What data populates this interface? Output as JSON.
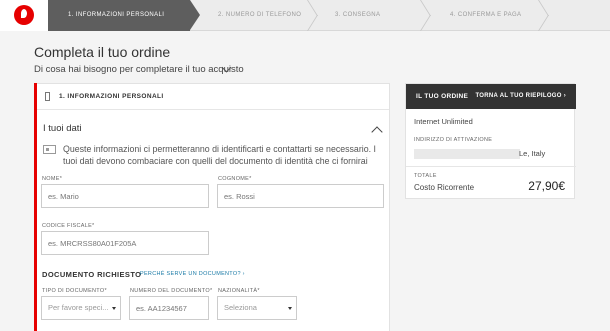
{
  "brand": {
    "accent": "#e60000",
    "logo_icon": "vodafone-logo-icon"
  },
  "steps": [
    {
      "label": "1. INFORMAZIONI PERSONALI",
      "active": true
    },
    {
      "label": "2. NUMERO DI TELEFONO",
      "active": false
    },
    {
      "label": "3. CONSEGNA",
      "active": false
    },
    {
      "label": "4. CONFERMA E PAGA",
      "active": false
    }
  ],
  "page": {
    "title": "Completa il tuo ordine",
    "subtitle": "Di cosa hai bisogno per completare il tuo acquisto"
  },
  "form": {
    "section_header": "1. INFORMAZIONI PERSONALI",
    "section_title": "I tuoi dati",
    "info_text": "Queste informazioni ci permetteranno di identificarti e contattarti se necessario. I tuoi dati devono combaciare con quelli del documento di identità che ci fornirai",
    "nome": {
      "label": "NOME*",
      "placeholder": "es. Mario"
    },
    "cognome": {
      "label": "COGNOME*",
      "placeholder": "es. Rossi"
    },
    "codice_fiscale": {
      "label": "CODICE FISCALE*",
      "placeholder": "es. MRCRSS80A01F205A"
    },
    "document_heading": "DOCUMENTO RICHIESTO",
    "document_link": "PERCHÉ SERVE UN DOCUMENTO? ›",
    "tipo_documento": {
      "label": "TIPO DI DOCUMENTO*",
      "value": "Per favore speci..."
    },
    "numero_documento": {
      "label": "NUMERO DEL DOCUMENTO*",
      "placeholder": "es. AA1234567"
    },
    "nazionalita": {
      "label": "NAZIONALITÀ*",
      "value": "Seleziona"
    }
  },
  "summary": {
    "title": "IL TUO ORDINE",
    "link": "TORNA AL TUO RIEPILOGO ›",
    "product": "Internet Unlimited",
    "address_label": "INDIRIZZO DI ATTIVAZIONE",
    "address_value": "Le, Italy",
    "total_label": "TOTALE",
    "cost_label": "Costo Ricorrente",
    "price": "27,90€"
  }
}
